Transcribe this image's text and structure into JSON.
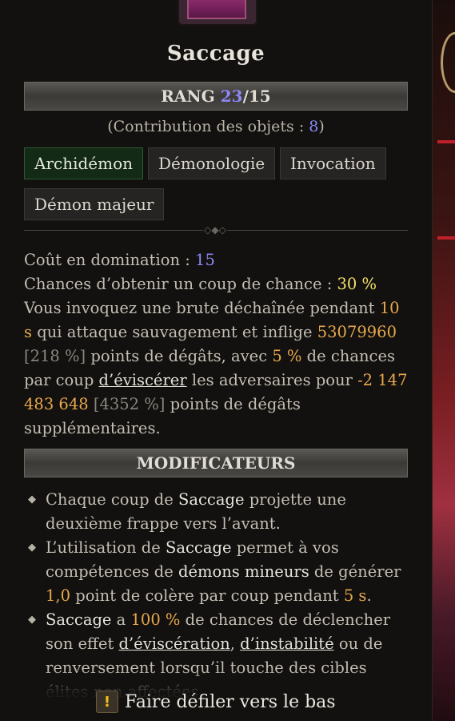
{
  "skill": {
    "title": "Saccage",
    "rank_label": "RANG",
    "rank_current": "23",
    "rank_separator": "/",
    "rank_max": "15",
    "contribution_prefix": "(Contribution des objets : ",
    "contribution_value": "8",
    "contribution_suffix": ")",
    "tags": [
      "Archidémon",
      "Démonologie",
      "Invocation",
      "Démon majeur"
    ]
  },
  "description": {
    "cost_label": "Coût en domination : ",
    "cost_value": "15",
    "luck_label": "Chances d’obtenir un coup de chance : ",
    "luck_value": "30 %",
    "text_1": "Vous invoquez une brute déchaînée pendant ",
    "duration": "10 s",
    "text_2": "qui attaque sauvagement et inflige ",
    "damage": "53079960",
    "damage_pct": "[218 %]",
    "text_3": " points de dégâts, avec ",
    "chance": "5 %",
    "text_4": " de chances par coup ",
    "link_eviscerate": "d’éviscérer",
    "text_5": " les adversaires pour ",
    "bonus_damage": "-2 147 483 648",
    "bonus_pct": "[4352 %]",
    "text_6": " points de dégâts supplémentaires."
  },
  "modifiers": {
    "header": "MODIFICATEURS",
    "m1_a": "Chaque coup de ",
    "m1_skill": "Saccage",
    "m1_b": " projette une deuxième frappe vers l’avant.",
    "m2_a": "L’utilisation de ",
    "m2_skill": "Saccage",
    "m2_b": " permet à vos compétences de ",
    "m2_keyword": "démons mineurs",
    "m2_c": " de générer ",
    "m2_value": "1,0",
    "m2_d": " point de colère par coup pendant ",
    "m2_duration": "5 s",
    "m2_e": ".",
    "m3_skill": "Saccage",
    "m3_a": " a ",
    "m3_value": "100 %",
    "m3_b": " de chances de déclencher son effet ",
    "m3_link1": "d’éviscération",
    "m3_c": ", ",
    "m3_link2": "d’instabilité",
    "m3_d": " ou de renversement lorsqu’il touche des cibles élites non affectées."
  },
  "footer": {
    "scroll_label": "Faire défiler vers le bas",
    "scroll_icon": "!"
  }
}
